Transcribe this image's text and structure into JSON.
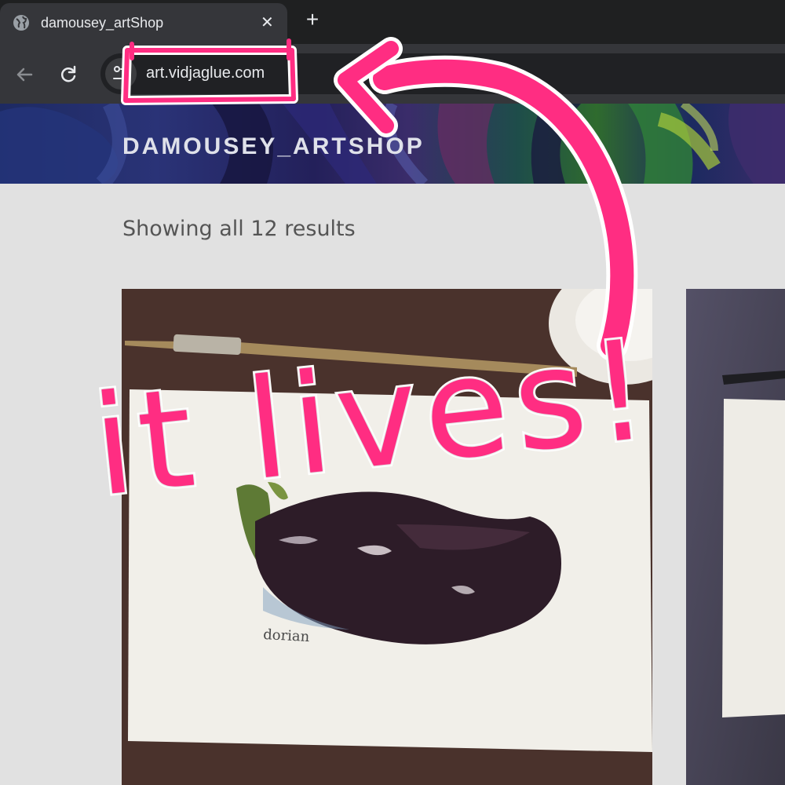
{
  "browser": {
    "tab_title": "damousey_artShop",
    "close_symbol": "✕",
    "new_tab_symbol": "+",
    "url": "art.vidjaglue.com",
    "icons": {
      "favicon": "globe-icon",
      "back": "back-arrow-icon",
      "reload": "reload-icon",
      "site_info": "tune-icon"
    }
  },
  "site": {
    "title": "DAMOUSEY_ARTSHOP",
    "results_text": "Showing all 12 results"
  },
  "products": [
    {
      "image": "eggplant-watercolor-painting",
      "signature": "dorian"
    },
    {
      "image": "watercolor-paper-with-pen"
    }
  ],
  "annotation": {
    "text": "it lives!",
    "color": "#ff2d82",
    "outline_color": "#ffffff"
  }
}
